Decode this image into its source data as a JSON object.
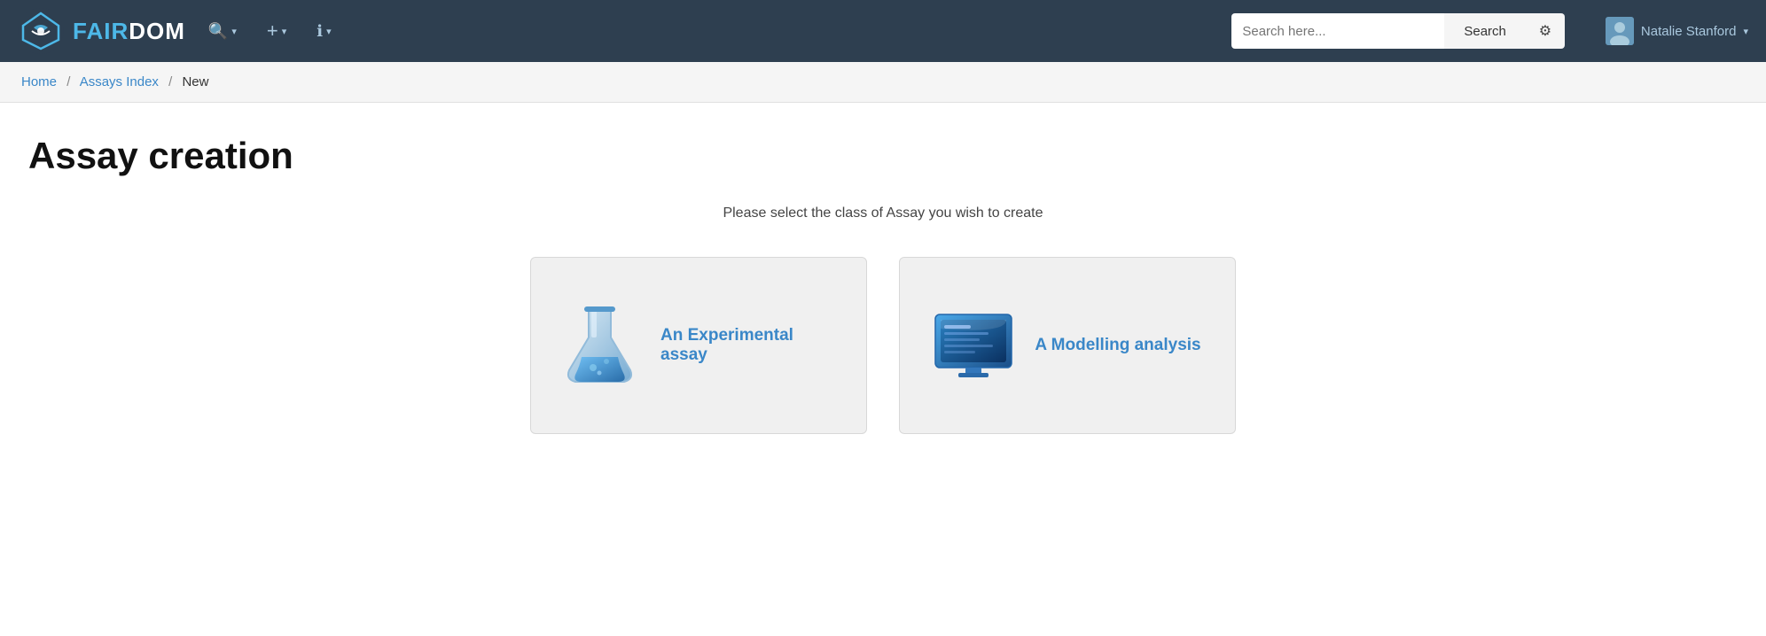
{
  "app": {
    "name_fair": "FAIR",
    "name_dom": "DOM"
  },
  "navbar": {
    "search_placeholder": "Search here...",
    "search_button_label": "Search",
    "user_name": "Natalie Stanford",
    "nav_items": [
      {
        "icon": "🔍",
        "label": "search-icon",
        "has_caret": true
      },
      {
        "icon": "+",
        "label": "plus-icon",
        "has_caret": true
      },
      {
        "icon": "ℹ",
        "label": "info-icon",
        "has_caret": true
      }
    ]
  },
  "breadcrumb": {
    "items": [
      {
        "label": "Home",
        "href": "#",
        "link": true
      },
      {
        "label": "Assays Index",
        "href": "#",
        "link": true
      },
      {
        "label": "New",
        "link": false
      }
    ]
  },
  "page": {
    "title": "Assay creation",
    "subtitle": "Please select the class of Assay you wish to create"
  },
  "cards": [
    {
      "id": "experimental",
      "label": "An Experimental assay",
      "icon_type": "flask"
    },
    {
      "id": "modelling",
      "label": "A Modelling analysis",
      "icon_type": "monitor"
    }
  ]
}
